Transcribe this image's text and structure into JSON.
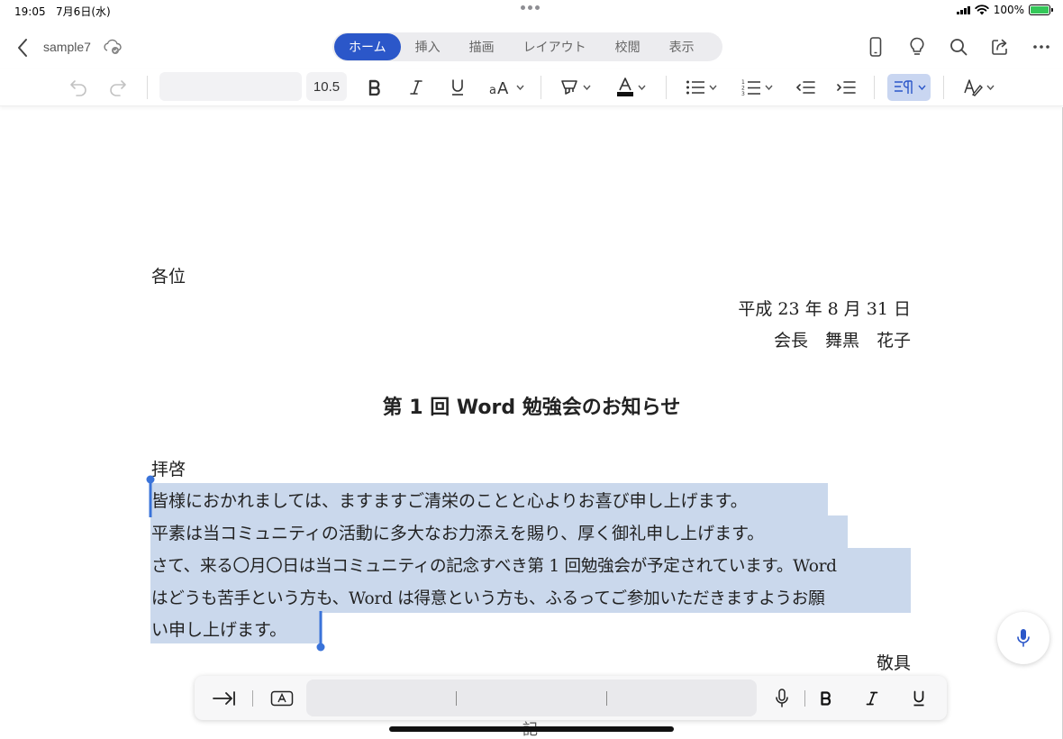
{
  "status": {
    "time": "19:05",
    "date": "7月6日(水)",
    "battery": "100%"
  },
  "app": {
    "doc_name": "sample7"
  },
  "tabs": [
    {
      "label": "ホーム",
      "active": true
    },
    {
      "label": "挿入",
      "active": false
    },
    {
      "label": "描画",
      "active": false
    },
    {
      "label": "レイアウト",
      "active": false
    },
    {
      "label": "校閲",
      "active": false
    },
    {
      "label": "表示",
      "active": false
    }
  ],
  "toolbar": {
    "font_name": "",
    "font_size": "10.5"
  },
  "document": {
    "addressee": "各位",
    "date": "平成 23 年 8 月 31 日",
    "sender": "会長　舞黒　花子",
    "title": "第 1 回 Word 勉強会のお知らせ",
    "greeting": "拝啓",
    "body_lines": [
      "皆様におかれましては、ますますご清栄のことと心よりお喜び申し上げます。",
      "平素は当コミュニティの活動に多大なお力添えを賜り、厚く御礼申し上げます。",
      "さて、来る〇月〇日は当コミュニティの記念すべき第 1 回勉強会が予定されています。Word",
      "はどうも苦手という方も、Word は得意という方も、ふるってご参加いただきますようお願",
      "い申し上げます。"
    ],
    "closing": "敬具",
    "partial_next": "記"
  },
  "colors": {
    "accent": "#2b57c9",
    "selection": "#cad8ec",
    "handle": "#3a73d9"
  }
}
